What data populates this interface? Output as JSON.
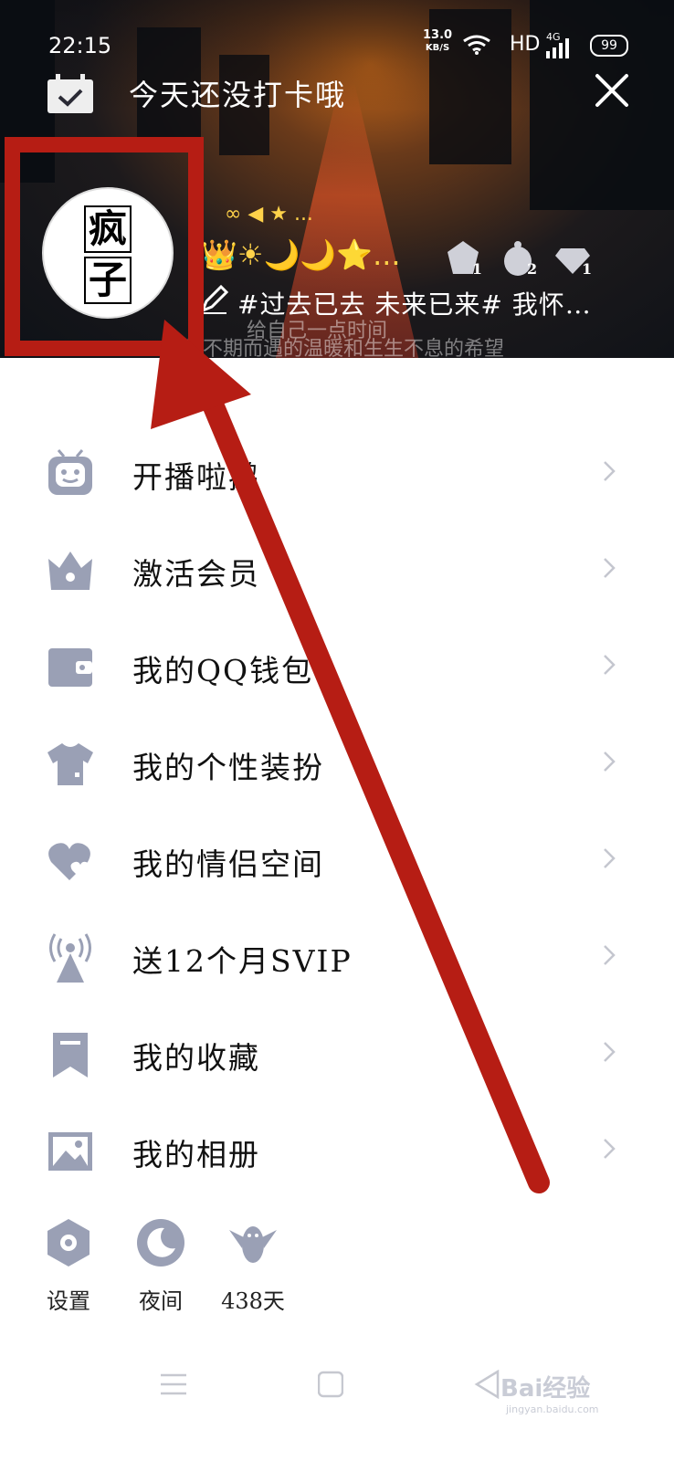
{
  "status_bar": {
    "time": "22:15",
    "net_speed": "13.0",
    "net_unit": "KB/S",
    "hd": "HD",
    "network": "4G",
    "battery": "99"
  },
  "topbar": {
    "checkin_text": "今天还没打卡哦",
    "calendar_icon": "calendar-check-icon",
    "close_icon": "close-icon"
  },
  "profile": {
    "avatar_chars": [
      "疯",
      "子"
    ],
    "level_badges": "👑☀🌙🌙⭐...",
    "level_badges_top": "∞ ◀ ★ ...",
    "medals": [
      "1",
      "2",
      "1"
    ],
    "signature": "#过去已去 未来已来# 我怀…",
    "faint_line1": "给自己一点时间",
    "faint_line2": "与不期而遇的温暖和生生不息的希望"
  },
  "menu": {
    "items": [
      {
        "label": "开播啦鹅",
        "icon": "tv-robot-icon"
      },
      {
        "label": "激活会员",
        "icon": "crown-icon"
      },
      {
        "label": "我的QQ钱包",
        "icon": "wallet-icon"
      },
      {
        "label": "我的个性装扮",
        "icon": "tshirt-icon"
      },
      {
        "label": "我的情侣空间",
        "icon": "hearts-icon"
      },
      {
        "label": "送12个月SVIP",
        "icon": "broadcast-tower-icon"
      },
      {
        "label": "我的收藏",
        "icon": "bookmark-icon"
      },
      {
        "label": "我的相册",
        "icon": "image-icon"
      }
    ]
  },
  "bottom": {
    "settings": "设置",
    "night": "夜间",
    "days": "438天"
  },
  "watermark": {
    "brand": "Bai经验",
    "url": "jingyan.baidu.com"
  },
  "colors": {
    "icon": "#9aa0b5",
    "annotation": "#b61d14",
    "arrow_chevron": "#c4c6cf"
  }
}
